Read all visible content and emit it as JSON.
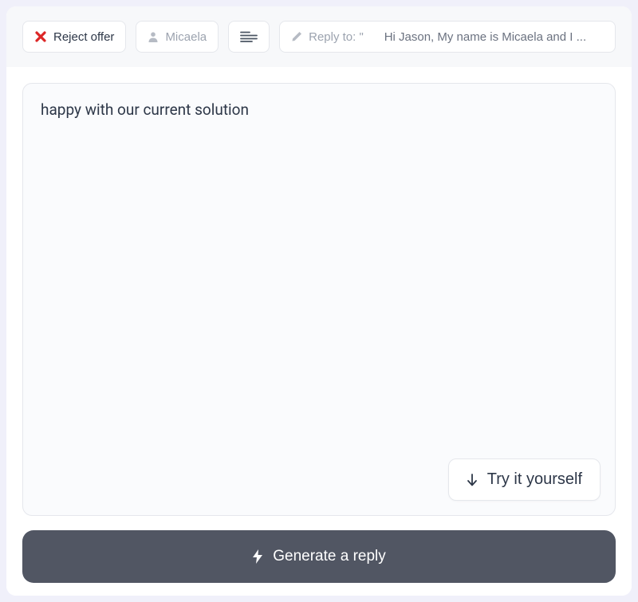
{
  "toolbar": {
    "reject": {
      "label": "Reject offer"
    },
    "persona": {
      "label": "Micaela"
    },
    "reply": {
      "prefix": "Reply to: \" ",
      "quoted": "Hi Jason, My name is Micaela and I ..."
    }
  },
  "main": {
    "textarea_value": "happy with our current solution",
    "try_label": "Try it yourself"
  },
  "footer": {
    "generate_label": "Generate a reply"
  }
}
